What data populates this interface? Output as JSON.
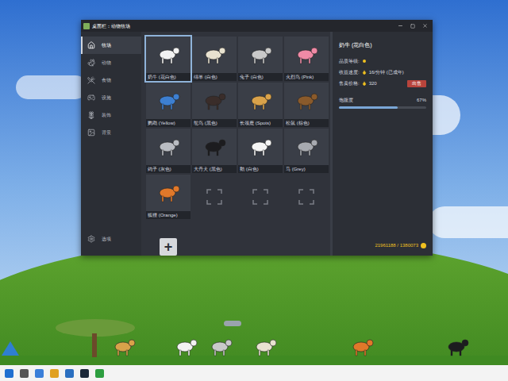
{
  "window": {
    "title": "桌面栏：动物牧场"
  },
  "sidebar": {
    "items": [
      {
        "label": "牧场",
        "selected": true
      },
      {
        "label": "动物",
        "selected": false
      },
      {
        "label": "食物",
        "selected": false
      },
      {
        "label": "设施",
        "selected": false
      },
      {
        "label": "装饰",
        "selected": false
      },
      {
        "label": "背景",
        "selected": false
      }
    ],
    "options": "选项"
  },
  "slots": [
    {
      "kind": "animal",
      "label": "奶牛 (花白色)",
      "selected": true,
      "color": "#f2f2f2"
    },
    {
      "kind": "animal",
      "label": "绵羊 (白色)",
      "selected": false,
      "color": "#e8e2d0"
    },
    {
      "kind": "animal",
      "label": "兔子 (白色)",
      "selected": false,
      "color": "#c9c9c9"
    },
    {
      "kind": "animal",
      "label": "火烈鸟 (Pink)",
      "selected": false,
      "color": "#f08aa6"
    },
    {
      "kind": "animal",
      "label": "鹦鹉 (Yellow)",
      "selected": false,
      "color": "#3d7fd1"
    },
    {
      "kind": "animal",
      "label": "鸵鸟 (黑色)",
      "selected": false,
      "color": "#3a2d2a"
    },
    {
      "kind": "animal",
      "label": "长颈鹿 (Spots)",
      "selected": false,
      "color": "#d9a24a"
    },
    {
      "kind": "animal",
      "label": "松鼠 (棕色)",
      "selected": false,
      "color": "#8a5a2b"
    },
    {
      "kind": "animal",
      "label": "鸽子 (灰色)",
      "selected": false,
      "color": "#b9bcc2"
    },
    {
      "kind": "animal",
      "label": "大丹犬 (黑色)",
      "selected": false,
      "color": "#1c1c1f"
    },
    {
      "kind": "animal",
      "label": "鹅 (白色)",
      "selected": false,
      "color": "#f4f4f4"
    },
    {
      "kind": "animal",
      "label": "马 (Grey)",
      "selected": false,
      "color": "#a7aab0"
    },
    {
      "kind": "animal",
      "label": "狐狸 (Orange)",
      "selected": false,
      "color": "#e0782a"
    },
    {
      "kind": "empty",
      "label": "",
      "selected": false,
      "color": "#7a7e87"
    },
    {
      "kind": "empty",
      "label": "",
      "selected": false,
      "color": "#7a7e87"
    },
    {
      "kind": "empty",
      "label": "",
      "selected": false,
      "color": "#7a7e87"
    }
  ],
  "add_button": "+",
  "detail": {
    "title": "奶牛 (花白色)",
    "quality": {
      "label": "品质等级:",
      "stars": 1
    },
    "income": {
      "label": "收益速度:",
      "value": "16/分钟 (已成年)"
    },
    "price": {
      "label": "售卖价格:",
      "value": "320",
      "button": "出售"
    },
    "satiety": {
      "label": "饱腹度",
      "reading": "67%",
      "level": 0.67
    }
  },
  "coins": "21961188 / 1380073"
}
